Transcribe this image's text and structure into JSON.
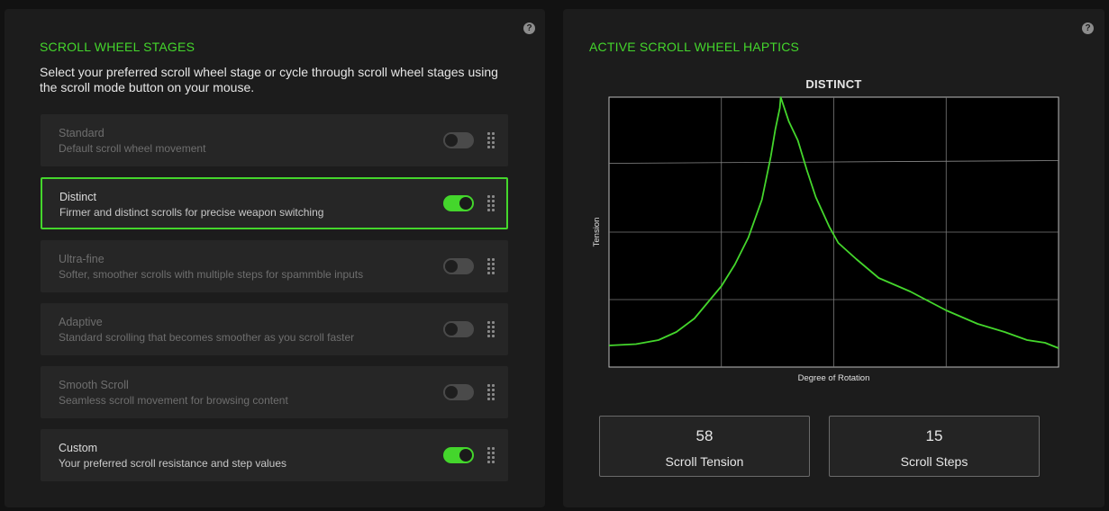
{
  "help_glyph": "?",
  "scroll_stages": {
    "title": "SCROLL WHEEL STAGES",
    "description": "Select your preferred scroll wheel stage or cycle through scroll wheel stages using the scroll mode button on your mouse.",
    "stages": [
      {
        "name": "Standard",
        "description": "Default scroll wheel movement",
        "enabled": false,
        "selected": false
      },
      {
        "name": "Distinct",
        "description": "Firmer and distinct scrolls for precise weapon switching",
        "enabled": true,
        "selected": true
      },
      {
        "name": "Ultra-fine",
        "description": "Softer, smoother scrolls with multiple steps for spammble inputs",
        "enabled": false,
        "selected": false
      },
      {
        "name": "Adaptive",
        "description": "Standard scrolling that becomes smoother as you scroll faster",
        "enabled": false,
        "selected": false
      },
      {
        "name": "Smooth Scroll",
        "description": "Seamless scroll movement for browsing content",
        "enabled": false,
        "selected": false
      },
      {
        "name": "Custom",
        "description": "Your preferred scroll resistance and step values",
        "enabled": true,
        "selected": false
      }
    ]
  },
  "haptics": {
    "title": "ACTIVE SCROLL WHEEL HAPTICS",
    "scroll_tension": {
      "value": "58",
      "label": "Scroll Tension"
    },
    "scroll_steps": {
      "value": "15",
      "label": "Scroll Steps"
    }
  },
  "colors": {
    "accent": "#44d62c",
    "panel": "#1c1c1c",
    "card": "#262626"
  },
  "chart_data": {
    "type": "line",
    "title": "DISTINCT",
    "xlabel": "Degree of Rotation",
    "ylabel": "Tension",
    "xlim": [
      0,
      100
    ],
    "ylim": [
      0,
      100
    ],
    "grid": true,
    "series": [
      {
        "x": [
          0,
          6,
          11,
          15,
          19,
          23,
          25,
          28,
          31,
          34,
          36,
          37,
          38,
          38.2,
          39,
          40,
          42,
          44,
          46,
          49,
          51,
          55,
          60,
          67,
          75,
          82,
          88,
          93,
          97,
          100
        ],
        "y": [
          8,
          8.5,
          10,
          13,
          18,
          26,
          30,
          38,
          48,
          62,
          78,
          88,
          96,
          100,
          96,
          91,
          84,
          73,
          63,
          52,
          46,
          40,
          33,
          28,
          21,
          16,
          13,
          10,
          9,
          7
        ]
      }
    ],
    "reference_line": {
      "x": [
        0,
        100
      ],
      "y": [
        75.5,
        76.5
      ]
    }
  }
}
